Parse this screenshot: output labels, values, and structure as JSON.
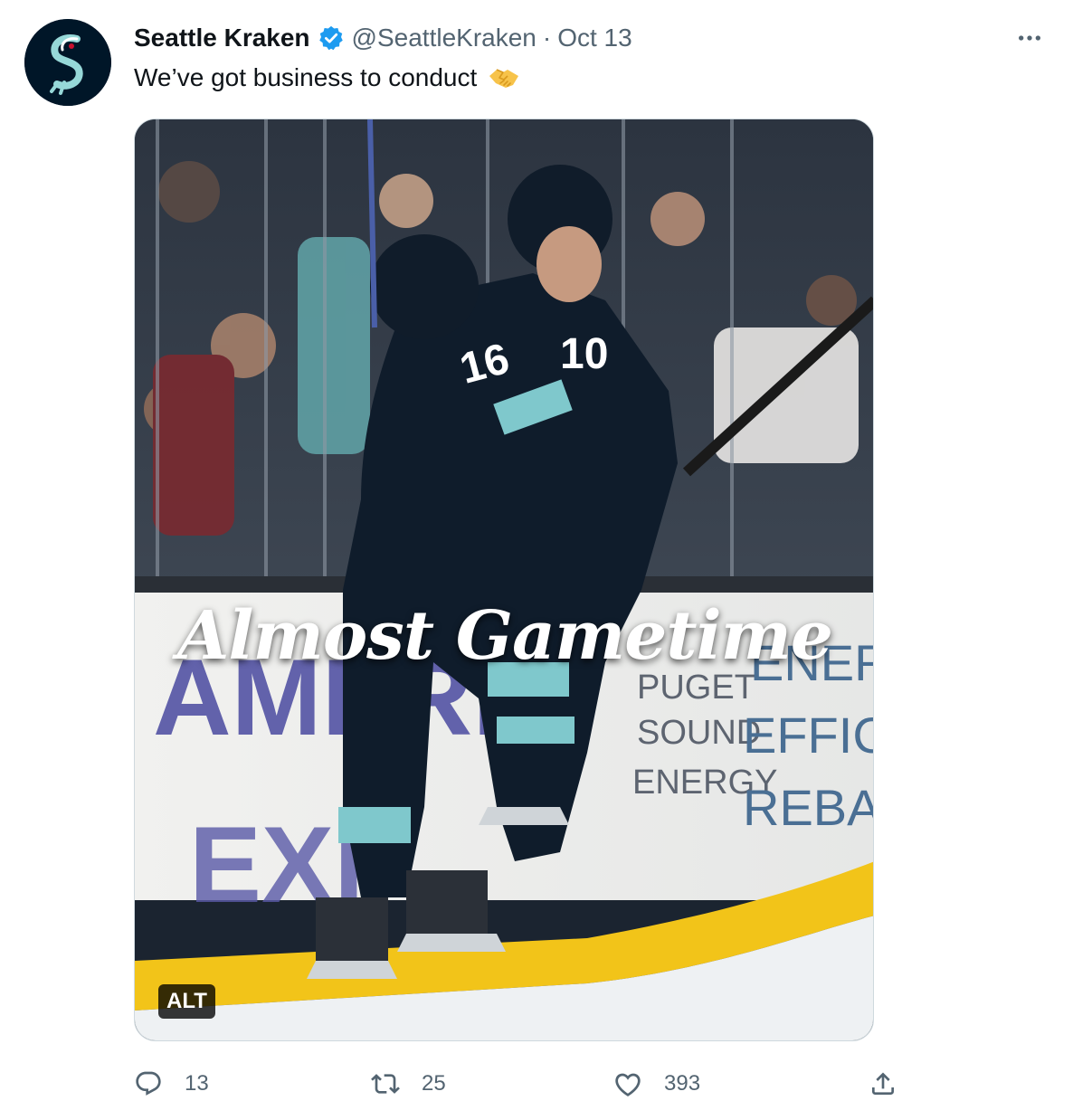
{
  "tweet": {
    "author_name": "Seattle Kraken",
    "author_handle": "@SeattleKraken",
    "separator": "·",
    "date": "Oct 13",
    "text": "We’ve got business to conduct",
    "verified": true,
    "avatar_icon": "kraken-logo-icon",
    "emoji_icon": "handshake-emoji-icon",
    "media": {
      "overlay_text": "Almost Gametime",
      "alt_label": "ALT",
      "board_text": [
        "AMERI",
        "EXP",
        "PUGET",
        "SOUND",
        "ENERGY",
        "ENERGY",
        "EFFICIENC",
        "REBATES"
      ],
      "jersey_numbers": [
        "16",
        "10"
      ]
    },
    "actions": {
      "reply_count": "13",
      "retweet_count": "25",
      "like_count": "393"
    }
  },
  "colors": {
    "text_primary": "#0f1419",
    "text_secondary": "#536471",
    "verified_blue": "#1d9bf0",
    "kraken_navy": "#001628",
    "kraken_teal": "#96d8d8"
  }
}
